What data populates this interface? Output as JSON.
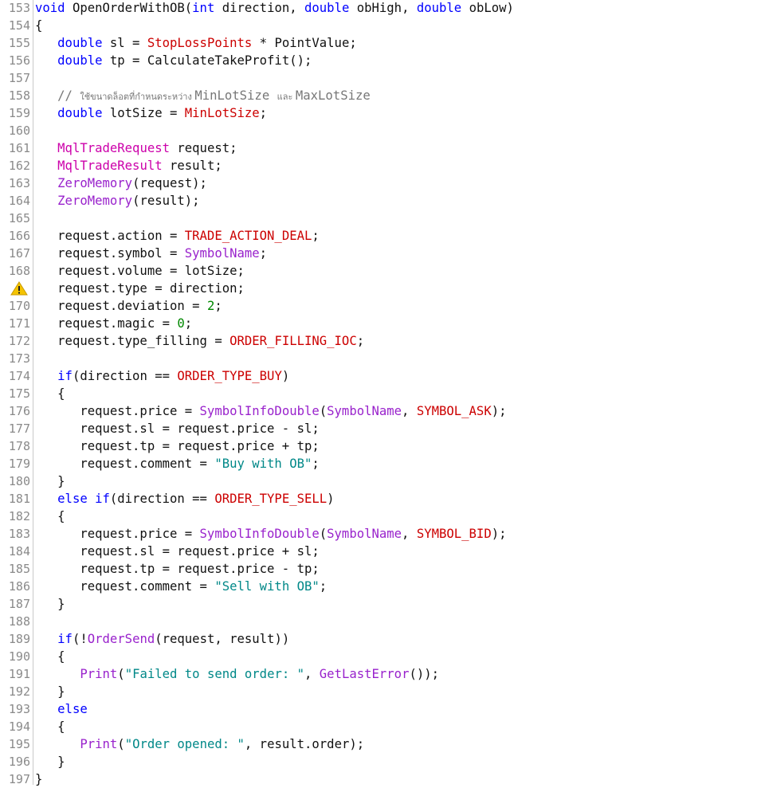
{
  "editor": {
    "warning_line": 169,
    "lines": [
      {
        "n": "153",
        "t": [
          [
            "void ",
            "kw"
          ],
          [
            "OpenOrderWithOB(",
            "txt"
          ],
          [
            "int ",
            "kw"
          ],
          [
            "direction, ",
            "txt"
          ],
          [
            "double ",
            "kw"
          ],
          [
            "obHigh, ",
            "txt"
          ],
          [
            "double ",
            "kw"
          ],
          [
            "obLow)",
            "txt"
          ]
        ]
      },
      {
        "n": "154",
        "t": [
          [
            "{",
            "txt"
          ]
        ]
      },
      {
        "n": "155",
        "t": [
          [
            "   ",
            "txt"
          ],
          [
            "double ",
            "kw"
          ],
          [
            "sl = ",
            "txt"
          ],
          [
            "StopLossPoints",
            "mac"
          ],
          [
            " * PointValue;",
            "txt"
          ]
        ]
      },
      {
        "n": "156",
        "t": [
          [
            "   ",
            "txt"
          ],
          [
            "double ",
            "kw"
          ],
          [
            "tp = CalculateTakeProfit();",
            "txt"
          ]
        ]
      },
      {
        "n": "157",
        "t": []
      },
      {
        "n": "158",
        "t": [
          [
            "   // ",
            "cmt"
          ],
          [
            "ใช้ขนาดล็อตที่กำหนดระหว่าง ",
            "cmt-small"
          ],
          [
            "MinLotSize ",
            "cmt"
          ],
          [
            "และ ",
            "cmt-small"
          ],
          [
            "MaxLotSize",
            "cmt"
          ]
        ]
      },
      {
        "n": "159",
        "t": [
          [
            "   ",
            "txt"
          ],
          [
            "double ",
            "kw"
          ],
          [
            "lotSize = ",
            "txt"
          ],
          [
            "MinLotSize",
            "mac"
          ],
          [
            ";",
            "txt"
          ]
        ]
      },
      {
        "n": "160",
        "t": []
      },
      {
        "n": "161",
        "t": [
          [
            "   ",
            "txt"
          ],
          [
            "MqlTradeRequest",
            "type"
          ],
          [
            " request;",
            "txt"
          ]
        ]
      },
      {
        "n": "162",
        "t": [
          [
            "   ",
            "txt"
          ],
          [
            "MqlTradeResult",
            "type"
          ],
          [
            " result;",
            "txt"
          ]
        ]
      },
      {
        "n": "163",
        "t": [
          [
            "   ",
            "txt"
          ],
          [
            "ZeroMemory",
            "fn"
          ],
          [
            "(request);",
            "txt"
          ]
        ]
      },
      {
        "n": "164",
        "t": [
          [
            "   ",
            "txt"
          ],
          [
            "ZeroMemory",
            "fn"
          ],
          [
            "(result);",
            "txt"
          ]
        ]
      },
      {
        "n": "165",
        "t": []
      },
      {
        "n": "166",
        "t": [
          [
            "   request.action = ",
            "txt"
          ],
          [
            "TRADE_ACTION_DEAL",
            "mac"
          ],
          [
            ";",
            "txt"
          ]
        ]
      },
      {
        "n": "167",
        "t": [
          [
            "   request.symbol = ",
            "txt"
          ],
          [
            "SymbolName",
            "fn"
          ],
          [
            ";",
            "txt"
          ]
        ]
      },
      {
        "n": "168",
        "t": [
          [
            "   request.volume = lotSize;",
            "txt"
          ]
        ]
      },
      {
        "n": "",
        "t": [
          [
            "   request.type = direction;",
            "txt"
          ]
        ]
      },
      {
        "n": "170",
        "t": [
          [
            "   request.deviation = ",
            "txt"
          ],
          [
            "2",
            "num"
          ],
          [
            ";",
            "txt"
          ]
        ]
      },
      {
        "n": "171",
        "t": [
          [
            "   request.magic = ",
            "txt"
          ],
          [
            "0",
            "num"
          ],
          [
            ";",
            "txt"
          ]
        ]
      },
      {
        "n": "172",
        "t": [
          [
            "   request.type_filling = ",
            "txt"
          ],
          [
            "ORDER_FILLING_IOC",
            "mac"
          ],
          [
            ";",
            "txt"
          ]
        ]
      },
      {
        "n": "173",
        "t": []
      },
      {
        "n": "174",
        "t": [
          [
            "   ",
            "txt"
          ],
          [
            "if",
            "kw"
          ],
          [
            "(direction == ",
            "txt"
          ],
          [
            "ORDER_TYPE_BUY",
            "mac"
          ],
          [
            ")",
            "txt"
          ]
        ]
      },
      {
        "n": "175",
        "t": [
          [
            "   {",
            "txt"
          ]
        ]
      },
      {
        "n": "176",
        "t": [
          [
            "      request.price = ",
            "txt"
          ],
          [
            "SymbolInfoDouble",
            "fn"
          ],
          [
            "(",
            "txt"
          ],
          [
            "SymbolName",
            "fn"
          ],
          [
            ", ",
            "txt"
          ],
          [
            "SYMBOL_ASK",
            "mac"
          ],
          [
            ");",
            "txt"
          ]
        ]
      },
      {
        "n": "177",
        "t": [
          [
            "      request.sl = request.price - sl;",
            "txt"
          ]
        ]
      },
      {
        "n": "178",
        "t": [
          [
            "      request.tp = request.price + tp;",
            "txt"
          ]
        ]
      },
      {
        "n": "179",
        "t": [
          [
            "      request.comment = ",
            "txt"
          ],
          [
            "\"Buy with OB\"",
            "str"
          ],
          [
            ";",
            "txt"
          ]
        ]
      },
      {
        "n": "180",
        "t": [
          [
            "   }",
            "txt"
          ]
        ]
      },
      {
        "n": "181",
        "t": [
          [
            "   ",
            "txt"
          ],
          [
            "else if",
            "kw"
          ],
          [
            "(direction == ",
            "txt"
          ],
          [
            "ORDER_TYPE_SELL",
            "mac"
          ],
          [
            ")",
            "txt"
          ]
        ]
      },
      {
        "n": "182",
        "t": [
          [
            "   {",
            "txt"
          ]
        ]
      },
      {
        "n": "183",
        "t": [
          [
            "      request.price = ",
            "txt"
          ],
          [
            "SymbolInfoDouble",
            "fn"
          ],
          [
            "(",
            "txt"
          ],
          [
            "SymbolName",
            "fn"
          ],
          [
            ", ",
            "txt"
          ],
          [
            "SYMBOL_BID",
            "mac"
          ],
          [
            ");",
            "txt"
          ]
        ]
      },
      {
        "n": "184",
        "t": [
          [
            "      request.sl = request.price + sl;",
            "txt"
          ]
        ]
      },
      {
        "n": "185",
        "t": [
          [
            "      request.tp = request.price - tp;",
            "txt"
          ]
        ]
      },
      {
        "n": "186",
        "t": [
          [
            "      request.comment = ",
            "txt"
          ],
          [
            "\"Sell with OB\"",
            "str"
          ],
          [
            ";",
            "txt"
          ]
        ]
      },
      {
        "n": "187",
        "t": [
          [
            "   }",
            "txt"
          ]
        ]
      },
      {
        "n": "188",
        "t": []
      },
      {
        "n": "189",
        "t": [
          [
            "   ",
            "txt"
          ],
          [
            "if",
            "kw"
          ],
          [
            "(!",
            "txt"
          ],
          [
            "OrderSend",
            "fn"
          ],
          [
            "(request, result))",
            "txt"
          ]
        ]
      },
      {
        "n": "190",
        "t": [
          [
            "   {",
            "txt"
          ]
        ]
      },
      {
        "n": "191",
        "t": [
          [
            "      ",
            "txt"
          ],
          [
            "Print",
            "fn"
          ],
          [
            "(",
            "txt"
          ],
          [
            "\"Failed to send order: \"",
            "str"
          ],
          [
            ", ",
            "txt"
          ],
          [
            "GetLastError",
            "fn"
          ],
          [
            "());",
            "txt"
          ]
        ]
      },
      {
        "n": "192",
        "t": [
          [
            "   }",
            "txt"
          ]
        ]
      },
      {
        "n": "193",
        "t": [
          [
            "   ",
            "txt"
          ],
          [
            "else",
            "kw"
          ]
        ]
      },
      {
        "n": "194",
        "t": [
          [
            "   {",
            "txt"
          ]
        ]
      },
      {
        "n": "195",
        "t": [
          [
            "      ",
            "txt"
          ],
          [
            "Print",
            "fn"
          ],
          [
            "(",
            "txt"
          ],
          [
            "\"Order opened: \"",
            "str"
          ],
          [
            ", result.order);",
            "txt"
          ]
        ]
      },
      {
        "n": "196",
        "t": [
          [
            "   }",
            "txt"
          ]
        ]
      },
      {
        "n": "197",
        "t": [
          [
            "}",
            "txt"
          ]
        ]
      }
    ]
  },
  "colors": {
    "keyword": "#0000ff",
    "macro": "#cc0000",
    "type": "#cc00aa",
    "function": "#9922cc",
    "string": "#008888",
    "number": "#008800",
    "comment": "#777777"
  },
  "icons": {
    "warning": "warning-icon"
  }
}
